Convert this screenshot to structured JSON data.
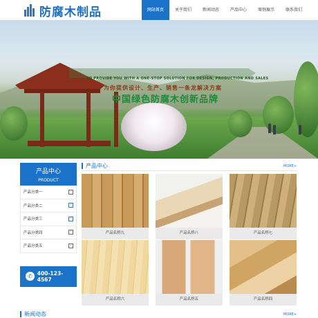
{
  "header": {
    "logo_text": "防腐木制品",
    "logo_icon": "building-bars-icon",
    "nav": [
      {
        "label": "网站首页",
        "active": true
      },
      {
        "label": "关于我们",
        "active": false
      },
      {
        "label": "新闻动态",
        "active": false
      },
      {
        "label": "产品中心",
        "active": false
      },
      {
        "label": "案例展示",
        "active": false
      },
      {
        "label": "联系我们",
        "active": false
      }
    ]
  },
  "banner": {
    "en_text": "TO PROVIDE YOU WITH A ONE-STOP SOLUTION FOR DESIGN, PRODUCTION AND SALES",
    "cn_sub": "为你提供设计、生产、销售一条龙解决方案",
    "cn_main": "中国绿色防腐木创新品牌"
  },
  "sidebar": {
    "title_cn": "产品中心",
    "title_en": "PRODUCT",
    "items": [
      {
        "label": "产品分类一"
      },
      {
        "label": "产品分类二"
      },
      {
        "label": "产品分类三"
      },
      {
        "label": "产品分类四"
      },
      {
        "label": "产品分类五"
      }
    ],
    "phone": "400-123-4567"
  },
  "products_section": {
    "title": "产品中心",
    "more": "MORE+",
    "items": [
      {
        "label": "产品名称九"
      },
      {
        "label": "产品名称八"
      },
      {
        "label": "产品名称七"
      },
      {
        "label": "产品名称六"
      },
      {
        "label": "产品名称五"
      },
      {
        "label": "产品名称四"
      }
    ]
  },
  "news_section": {
    "title": "新闻动态",
    "more": "MORE+"
  },
  "colors": {
    "brand_blue": "#1a73c9",
    "roof_red": "#8b2f1c",
    "slogan_green": "#1f8a3a"
  }
}
